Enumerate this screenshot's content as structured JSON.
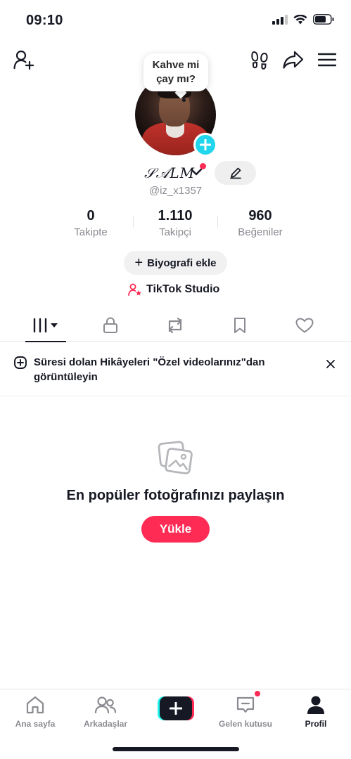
{
  "status_bar": {
    "time": "09:10"
  },
  "profile": {
    "bubble_text_line1": "Kahve mi",
    "bubble_text_line2": "çay mı?",
    "display_name": "𝒮𝒜𝐿𝑀",
    "handle": "@iz_x1357"
  },
  "stats": [
    {
      "value": "0",
      "label": "Takipte"
    },
    {
      "value": "1.110",
      "label": "Takipçi"
    },
    {
      "value": "960",
      "label": "Beğeniler"
    }
  ],
  "buttons": {
    "bio": "Biyografi ekle",
    "bio_plus": "+",
    "studio": "TikTok Studio",
    "upload": "Yükle"
  },
  "banner": {
    "text": "Süresi dolan Hikâyeleri \"Özel videolarınız\"dan görüntüleyin"
  },
  "empty_state": {
    "title": "En popüler fotoğrafınızı paylaşın"
  },
  "bottom_nav": [
    {
      "label": "Ana sayfa",
      "icon": "home-icon"
    },
    {
      "label": "Arkadaşlar",
      "icon": "friends-icon"
    },
    {
      "label": "",
      "icon": "create-icon"
    },
    {
      "label": "Gelen kutusu",
      "icon": "inbox-icon"
    },
    {
      "label": "Profil",
      "icon": "profile-icon"
    }
  ],
  "colors": {
    "accent": "#fe2c55",
    "cyan": "#20d5ec",
    "text": "#161823",
    "muted": "#8a8b91"
  }
}
